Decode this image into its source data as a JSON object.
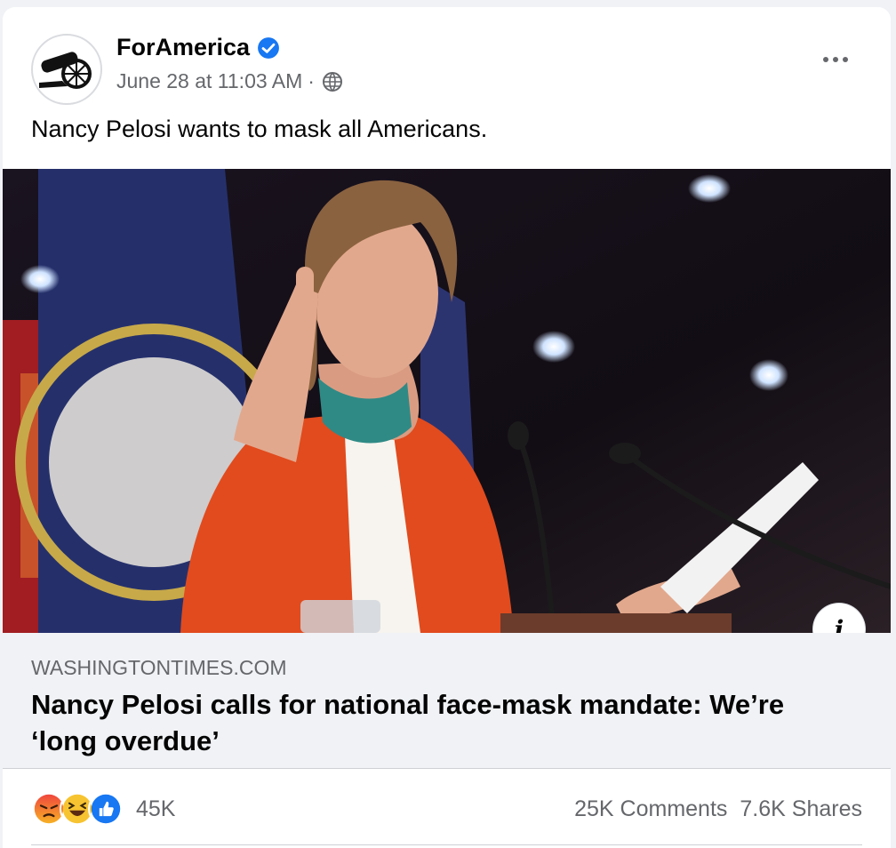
{
  "post": {
    "author": "ForAmerica",
    "verified": true,
    "date": "June 28 at 11:03 AM",
    "separator": "·",
    "audience_icon": "globe-icon",
    "text": "Nancy Pelosi wants to mask all Americans."
  },
  "link": {
    "domain": "WASHINGTONTIMES.COM",
    "headline": "Nancy Pelosi calls for national face-mask mandate: We’re ‘long overdue’"
  },
  "footer": {
    "reaction_icons": [
      "angry-reaction-icon",
      "haha-reaction-icon",
      "like-reaction-icon"
    ],
    "reaction_count": "45K",
    "comments": "25K Comments",
    "shares": "7.6K Shares"
  },
  "colors": {
    "accent": "#1877f2",
    "secondary_text": "#65676b",
    "link_background": "#f0f2f5"
  }
}
